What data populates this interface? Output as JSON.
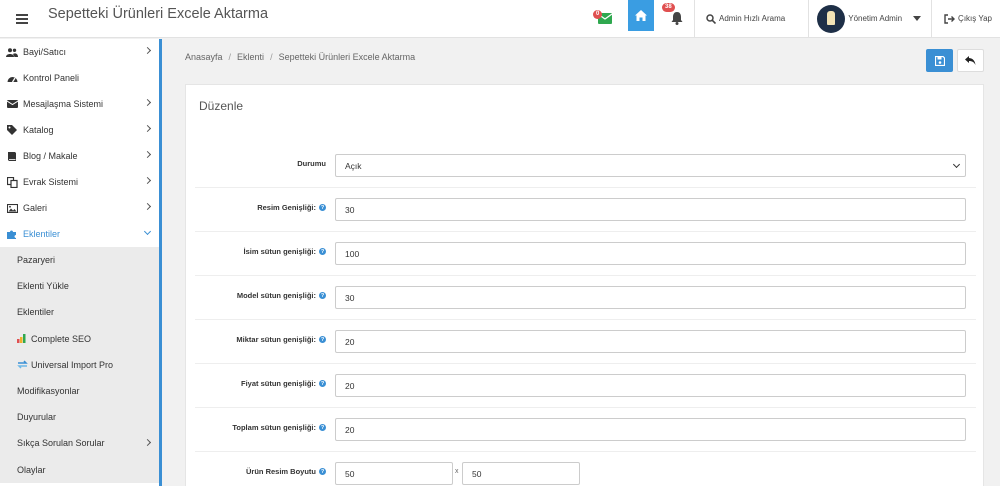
{
  "header": {
    "title": "Sepetteki Ürünleri Excele Aktarma",
    "mail_badge": "0",
    "bell_badge": "38",
    "search_label": "Admin Hızlı Arama",
    "user_label": "Yönetim Admin",
    "logout_label": "Çıkış Yap"
  },
  "sidebar": {
    "items": [
      {
        "label": "Bayi/Satıcı",
        "icon": "users-icon"
      },
      {
        "label": "Kontrol Paneli",
        "icon": "dashboard-icon"
      },
      {
        "label": "Mesajlaşma Sistemi",
        "icon": "envelope-icon"
      },
      {
        "label": "Katalog",
        "icon": "tags-icon"
      },
      {
        "label": "Blog / Makale",
        "icon": "book-icon"
      },
      {
        "label": "Evrak Sistemi",
        "icon": "documents-icon"
      },
      {
        "label": "Galeri",
        "icon": "image-icon"
      },
      {
        "label": "Eklentiler",
        "icon": "puzzle-icon"
      }
    ],
    "sub_items": [
      {
        "label": "Pazaryeri"
      },
      {
        "label": "Eklenti Yükle"
      },
      {
        "label": "Eklentiler"
      },
      {
        "label": "Complete SEO"
      },
      {
        "label": "Universal Import Pro"
      },
      {
        "label": "Modifikasyonlar"
      },
      {
        "label": "Duyurular"
      },
      {
        "label": "Sıkça Sorulan Sorular"
      },
      {
        "label": "Olaylar"
      }
    ]
  },
  "breadcrumb": [
    "Anasayfa",
    "Eklenti",
    "Sepetteki Ürünleri Excele Aktarma"
  ],
  "panel": {
    "title": "Düzenle",
    "fields": [
      {
        "label": "Durumu",
        "value": "Açık"
      },
      {
        "label": "Resim Genişliği:",
        "value": "30"
      },
      {
        "label": "İsim sütun genişliği:",
        "value": "100"
      },
      {
        "label": "Model sütun genişliği:",
        "value": "30"
      },
      {
        "label": "Miktar sütun genişliği:",
        "value": "20"
      },
      {
        "label": "Fiyat sütun genişliği:",
        "value": "20"
      },
      {
        "label": "Toplam sütun genişliği:",
        "value": "20"
      },
      {
        "label": "Ürün Resim Boyutu",
        "width": "50",
        "separator": "x",
        "height": "50"
      }
    ]
  },
  "colors": {
    "accent": "#3a8fd4",
    "mail_green": "#2fa84f",
    "badge_red": "#e05050"
  }
}
